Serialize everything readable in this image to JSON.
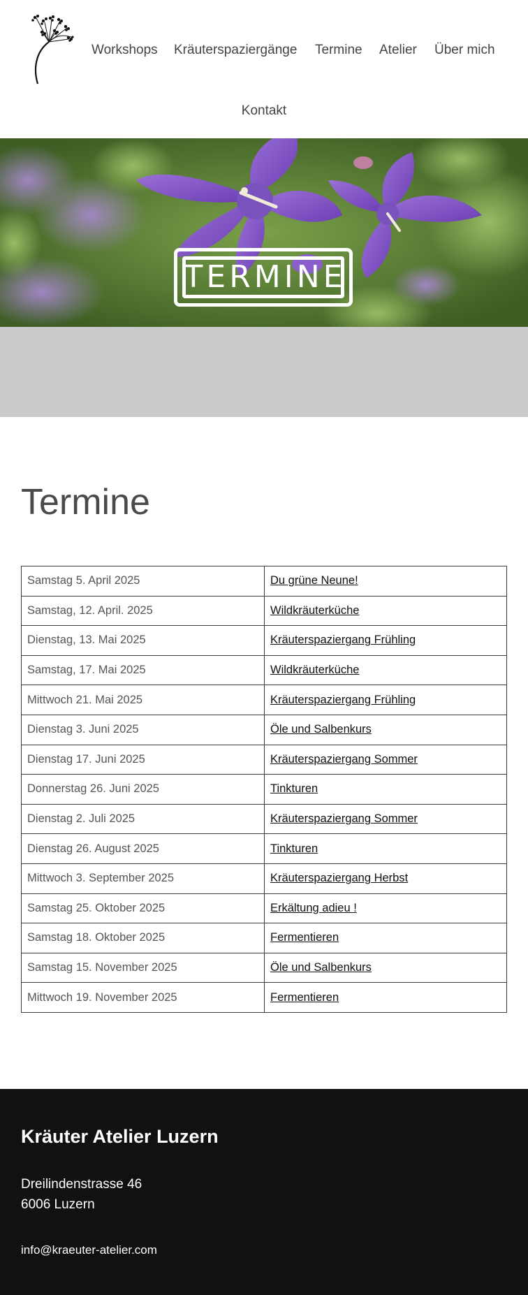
{
  "header": {
    "logo_icon": "herb-flower-logo-icon",
    "nav": {
      "items": [
        {
          "label": "Workshops"
        },
        {
          "label": "Kräuterspaziergänge"
        },
        {
          "label": "Termine"
        },
        {
          "label": "Atelier"
        },
        {
          "label": "Über mich"
        },
        {
          "label": "Kontakt"
        }
      ]
    }
  },
  "hero": {
    "sign_text": "TERMINE",
    "image_icon": "purple-bellflower-photo"
  },
  "main": {
    "title": "Termine",
    "events": [
      {
        "date": "Samstag 5. April 2025",
        "event": "Du grüne Neune!"
      },
      {
        "date": "Samstag, 12. April. 2025",
        "event": "Wildkräuterküche"
      },
      {
        "date": "Dienstag, 13. Mai 2025",
        "event": "Kräuterspaziergang Frühling"
      },
      {
        "date": "Samstag, 17. Mai 2025",
        "event": "Wildkräuterküche"
      },
      {
        "date": "Mittwoch 21. Mai 2025",
        "event": "Kräuterspaziergang Frühling"
      },
      {
        "date": "Dienstag 3. Juni 2025",
        "event": "Öle und Salbenkurs"
      },
      {
        "date": "Dienstag 17. Juni 2025",
        "event": "Kräuterspaziergang Sommer"
      },
      {
        "date": "Donnerstag 26. Juni 2025",
        "event": "Tinkturen"
      },
      {
        "date": "Dienstag 2. Juli 2025",
        "event": "Kräuterspaziergang Sommer"
      },
      {
        "date": "Dienstag 26. August 2025",
        "event": "Tinkturen"
      },
      {
        "date": "Mittwoch 3. September 2025",
        "event": "Kräuterspaziergang Herbst"
      },
      {
        "date": "Samstag 25. Oktober 2025",
        "event": "Erkältung adieu !"
      },
      {
        "date": "Samstag 18. Oktober 2025",
        "event": "Fermentieren"
      },
      {
        "date": "Samstag 15. November 2025",
        "event": "Öle und Salbenkurs"
      },
      {
        "date": "Mittwoch 19. November 2025",
        "event": "Fermentieren"
      }
    ]
  },
  "footer": {
    "title": "Kräuter Atelier Luzern",
    "street": "Dreilindenstrasse 46",
    "city": "6006 Luzern",
    "email": "info@kraeuter-atelier.com"
  },
  "colors": {
    "footer_bg": "#111111",
    "grey_band": "#cbcbcb",
    "text": "#444444",
    "flower_purple": "#8e5cc8"
  }
}
